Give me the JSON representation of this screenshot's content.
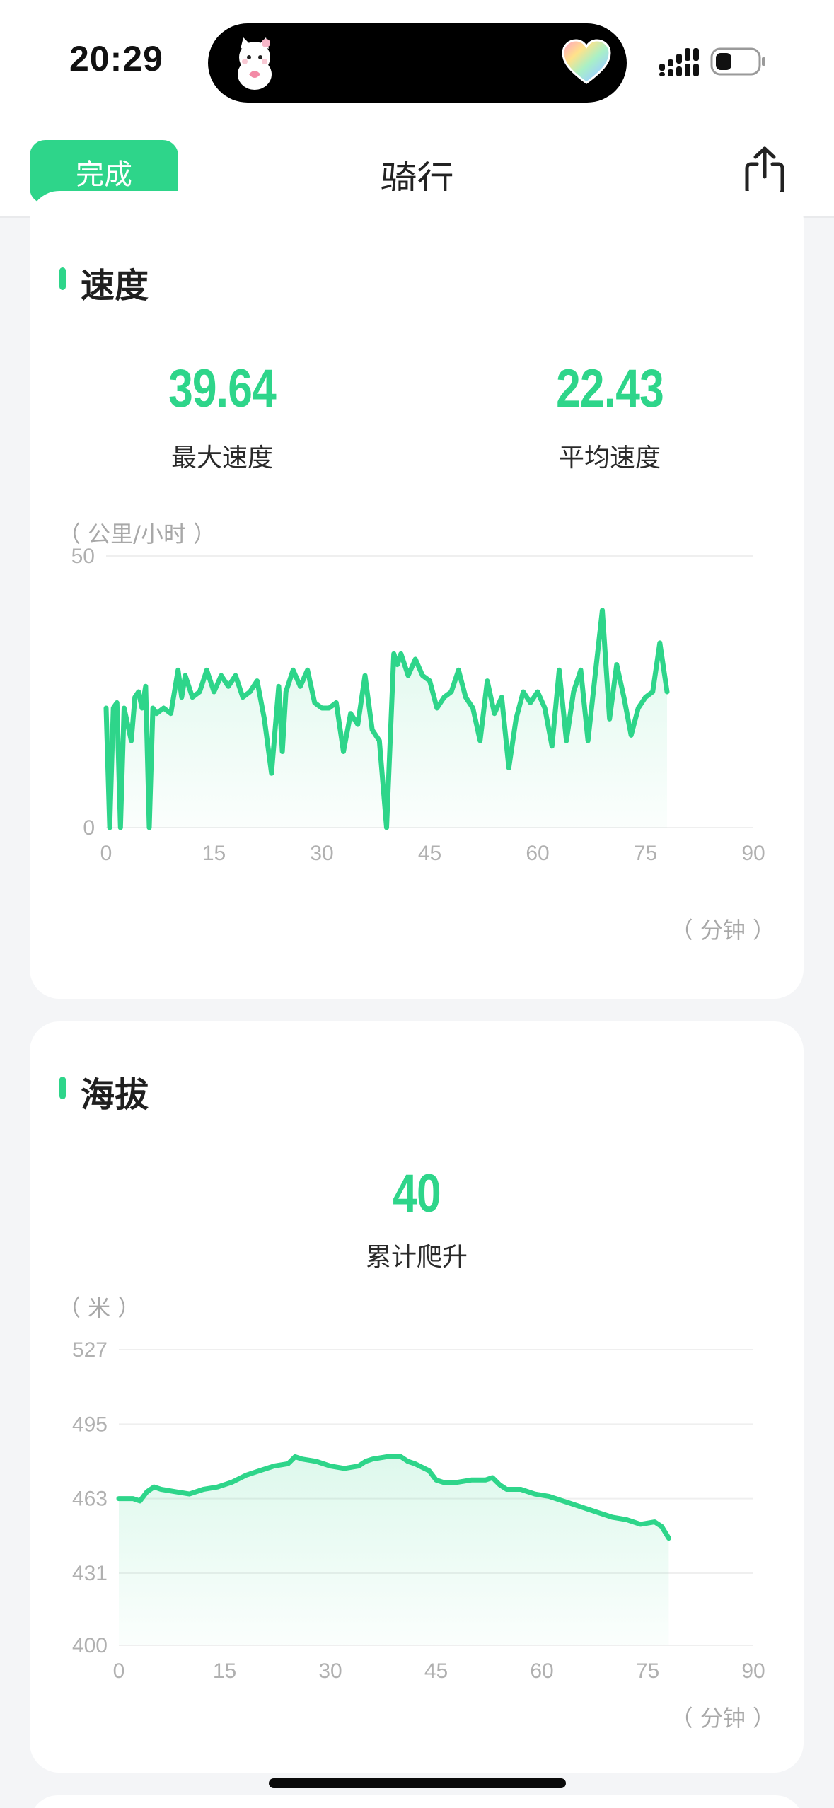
{
  "status_bar": {
    "time": "20:29",
    "icons": [
      "cat-sticker-icon",
      "rainbow-heart-icon",
      "signal-icon",
      "battery-icon"
    ]
  },
  "nav": {
    "done_label": "完成",
    "title": "骑行",
    "share_icon": "share-icon"
  },
  "colors": {
    "accent": "#2ed58a",
    "background": "#f4f5f7",
    "card": "#ffffff",
    "muted_text": "#a8a8a8"
  },
  "speed": {
    "title": "速度",
    "max_value": "39.64",
    "max_label": "最大速度",
    "avg_value": "22.43",
    "avg_label": "平均速度",
    "unit": "（ 公里/小时 ）",
    "axis_unit": "（ 分钟 ）"
  },
  "altitude": {
    "title": "海拔",
    "climb_value": "40",
    "climb_label": "累计爬升",
    "unit": "（ 米 ）",
    "axis_unit": "（ 分钟 ）"
  },
  "chart_data": [
    {
      "type": "area",
      "xlabel": "（ 分钟 ）",
      "ylabel": "（ 公里/小时 ）",
      "xlim": [
        0,
        90
      ],
      "ylim": [
        0,
        50
      ],
      "x_ticks": [
        "0",
        "15",
        "30",
        "45",
        "60",
        "75",
        "90"
      ],
      "y_ticks": [
        "0",
        "50"
      ],
      "grid": true,
      "series": [
        {
          "x": [
            0,
            0.5,
            1,
            1.5,
            2,
            2.5,
            3,
            3.5,
            4,
            4.5,
            5,
            5.5,
            6,
            6.5,
            7,
            8,
            9,
            10,
            10.5,
            11,
            12,
            13,
            14,
            15,
            16,
            17,
            18,
            19,
            20,
            21,
            22,
            23,
            24,
            24.5,
            25,
            26,
            27,
            28,
            29,
            30,
            31,
            32,
            33,
            34,
            35,
            36,
            37,
            38,
            39,
            40,
            40.5,
            41,
            42,
            43,
            44,
            45,
            46,
            47,
            48,
            49,
            50,
            51,
            52,
            53,
            54,
            55,
            56,
            57,
            58,
            59,
            60,
            61,
            62,
            63,
            64,
            65,
            66,
            67,
            68,
            69,
            70,
            71,
            72,
            73,
            74,
            75,
            76,
            77,
            78
          ],
          "y": [
            22,
            0,
            22,
            23,
            0,
            22,
            19,
            16,
            24,
            25,
            22,
            26,
            0,
            22,
            21,
            22,
            21,
            29,
            24,
            28,
            24,
            25,
            29,
            25,
            28,
            26,
            28,
            24,
            25,
            27,
            20,
            10,
            26,
            14,
            25,
            29,
            26,
            29,
            23,
            22,
            22,
            23,
            14,
            21,
            19,
            28,
            18,
            16,
            0,
            32,
            30,
            32,
            28,
            31,
            28,
            27,
            22,
            24,
            25,
            29,
            24,
            22,
            16,
            27,
            21,
            24,
            11,
            20,
            25,
            23,
            25,
            22,
            15,
            29,
            16,
            25,
            29,
            16,
            28,
            40,
            20,
            30,
            24,
            17,
            22,
            24,
            25,
            34,
            25
          ]
        }
      ]
    },
    {
      "type": "area",
      "xlabel": "（ 分钟 ）",
      "ylabel": "（ 米 ）",
      "xlim": [
        0,
        90
      ],
      "ylim": [
        400,
        527
      ],
      "x_ticks": [
        "0",
        "15",
        "30",
        "45",
        "60",
        "75",
        "90"
      ],
      "y_ticks": [
        "400",
        "431",
        "463",
        "495",
        "527"
      ],
      "grid": true,
      "series": [
        {
          "x": [
            0,
            2,
            3,
            4,
            5,
            6,
            8,
            10,
            12,
            14,
            16,
            18,
            20,
            22,
            24,
            25,
            26,
            28,
            30,
            32,
            34,
            35,
            36,
            38,
            40,
            41,
            42,
            44,
            45,
            46,
            48,
            50,
            52,
            53,
            54,
            55,
            57,
            59,
            61,
            63,
            64,
            66,
            68,
            70,
            72,
            74,
            76,
            77,
            78
          ],
          "y": [
            463,
            463,
            462,
            466,
            468,
            467,
            466,
            465,
            467,
            468,
            470,
            473,
            475,
            477,
            478,
            481,
            480,
            479,
            477,
            476,
            477,
            479,
            480,
            481,
            481,
            479,
            478,
            475,
            471,
            470,
            470,
            471,
            471,
            472,
            469,
            467,
            467,
            465,
            464,
            462,
            461,
            459,
            457,
            455,
            454,
            452,
            453,
            451,
            446
          ]
        }
      ]
    }
  ]
}
